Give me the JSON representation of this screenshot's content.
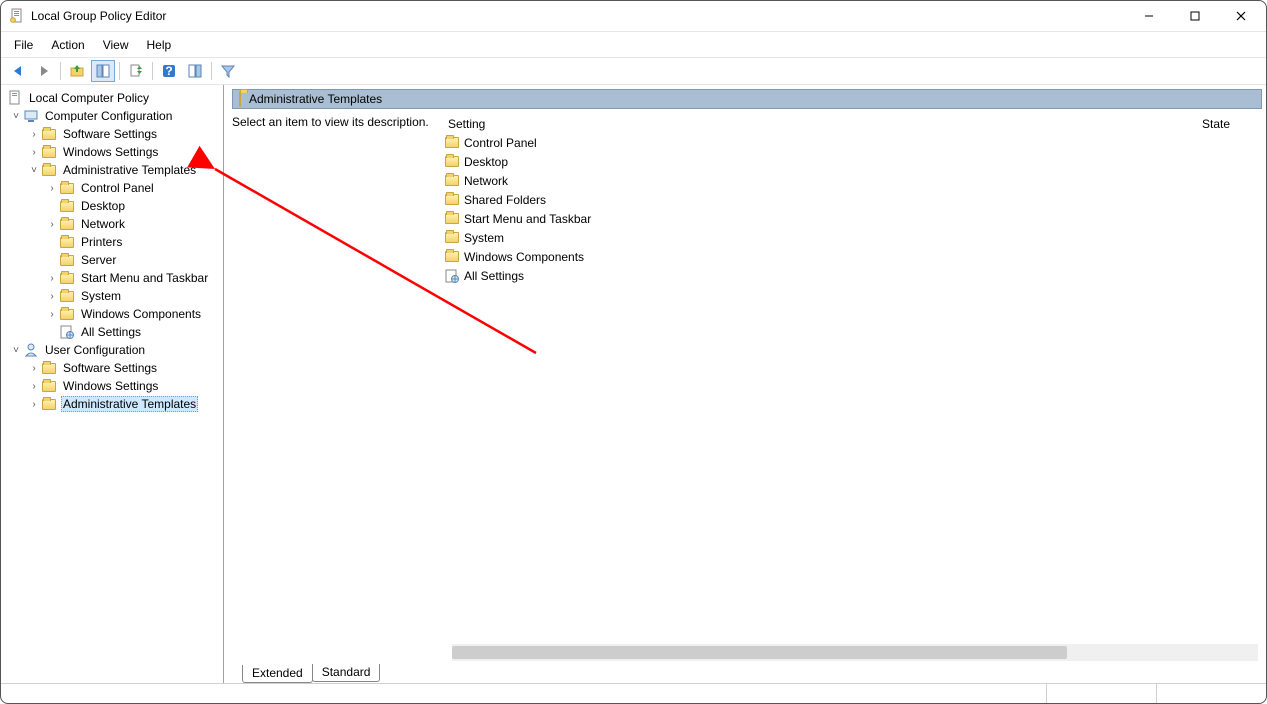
{
  "window": {
    "title": "Local Group Policy Editor"
  },
  "menu": {
    "items": [
      "File",
      "Action",
      "View",
      "Help"
    ]
  },
  "toolbar": {
    "back": "back-icon",
    "forward": "forward-icon",
    "up": "up-folder-icon",
    "show_hide_tree": "tree-toggle-icon",
    "export": "export-list-icon",
    "help": "help-icon",
    "show_hide_action": "action-pane-icon",
    "filter": "filter-icon"
  },
  "tree": {
    "root": {
      "label": "Local Computer Policy"
    },
    "computer": {
      "label": "Computer Configuration",
      "children": {
        "software": "Software Settings",
        "windows": "Windows Settings",
        "admin": {
          "label": "Administrative Templates",
          "children": {
            "control_panel": "Control Panel",
            "desktop": "Desktop",
            "network": "Network",
            "printers": "Printers",
            "server": "Server",
            "start_menu": "Start Menu and Taskbar",
            "system": "System",
            "win_components": "Windows Components",
            "all_settings": "All Settings"
          }
        }
      }
    },
    "user": {
      "label": "User Configuration",
      "children": {
        "software": "Software Settings",
        "windows": "Windows Settings",
        "admin": "Administrative Templates"
      }
    }
  },
  "content": {
    "crumb": "Administrative Templates",
    "desc_prompt": "Select an item to view its description.",
    "columns": {
      "setting": "Setting",
      "state": "State"
    },
    "items": [
      {
        "label": "Control Panel",
        "type": "folder"
      },
      {
        "label": "Desktop",
        "type": "folder"
      },
      {
        "label": "Network",
        "type": "folder"
      },
      {
        "label": "Shared Folders",
        "type": "folder"
      },
      {
        "label": "Start Menu and Taskbar",
        "type": "folder"
      },
      {
        "label": "System",
        "type": "folder"
      },
      {
        "label": "Windows Components",
        "type": "folder"
      },
      {
        "label": "All Settings",
        "type": "settings"
      }
    ]
  },
  "tabs": {
    "extended": "Extended",
    "standard": "Standard"
  }
}
